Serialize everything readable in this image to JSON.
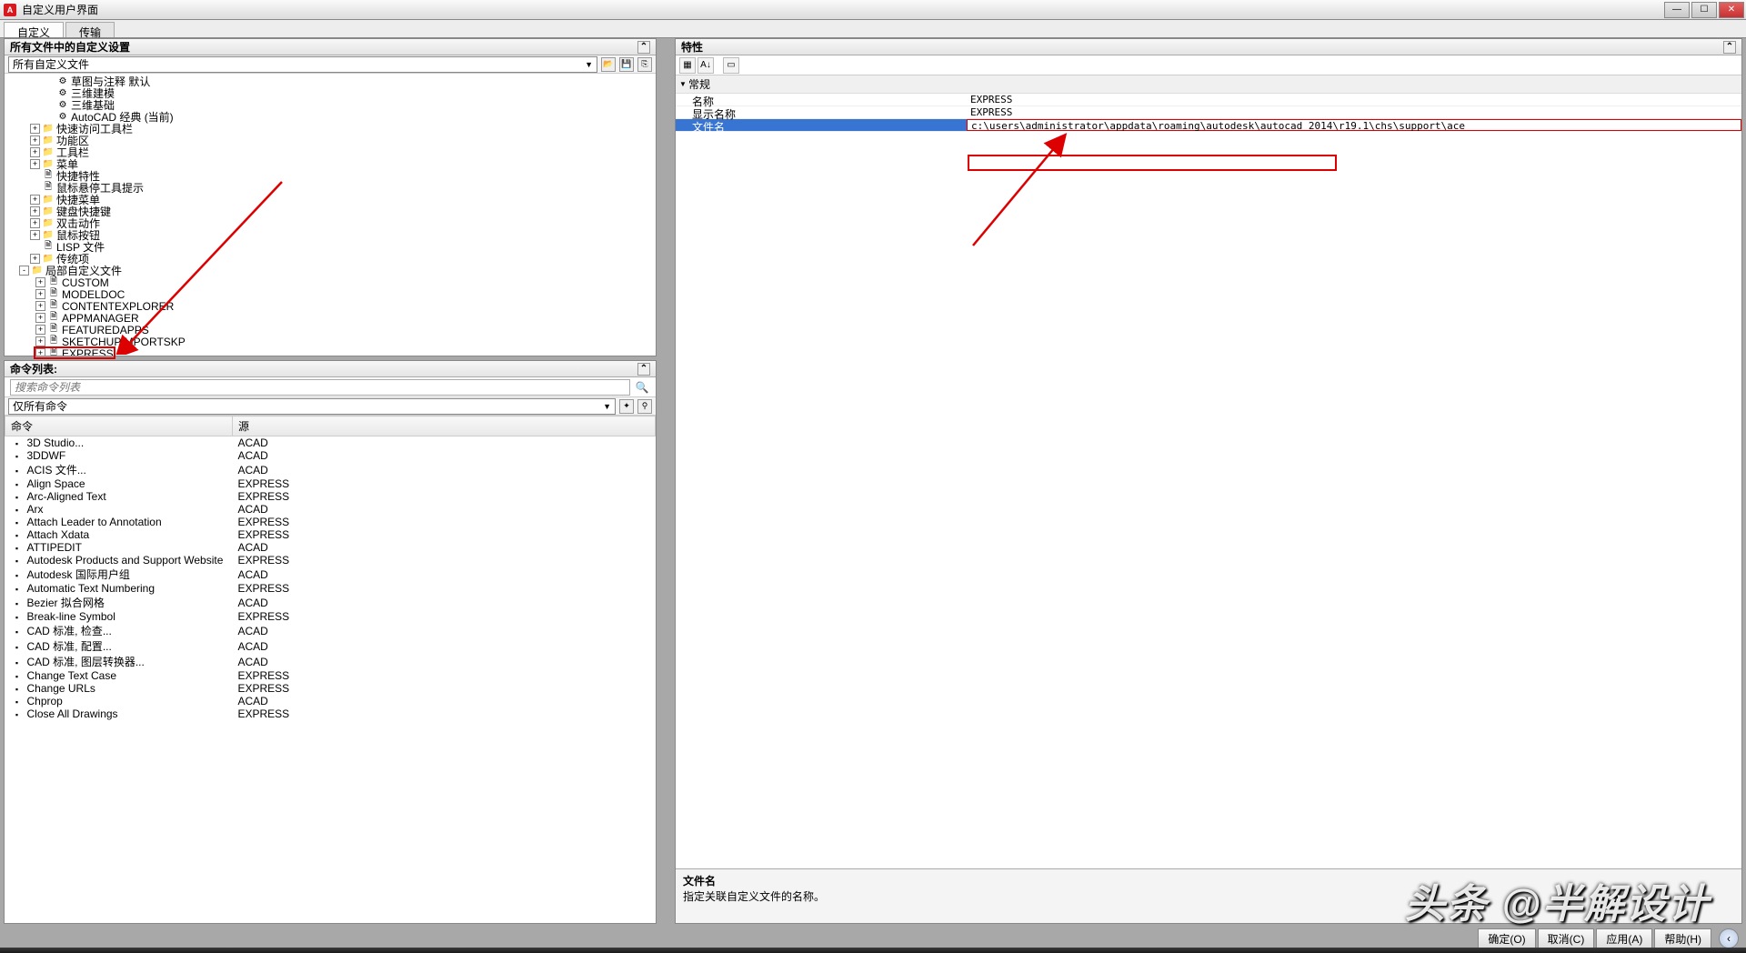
{
  "window": {
    "title": "自定义用户界面"
  },
  "tabs": [
    "自定义",
    "传输"
  ],
  "left": {
    "panel1_title": "所有文件中的自定义设置",
    "filter_label": "所有自定义文件",
    "tree": [
      {
        "ind": 40,
        "exp": "",
        "ico": "⚙",
        "txt": "草图与注释 默认"
      },
      {
        "ind": 40,
        "exp": "",
        "ico": "⚙",
        "txt": "三维建模"
      },
      {
        "ind": 40,
        "exp": "",
        "ico": "⚙",
        "txt": "三维基础"
      },
      {
        "ind": 40,
        "exp": "",
        "ico": "⚙",
        "txt": "AutoCAD 经典 (当前)"
      },
      {
        "ind": 24,
        "exp": "+",
        "ico": "📁",
        "txt": "快速访问工具栏"
      },
      {
        "ind": 24,
        "exp": "+",
        "ico": "📁",
        "txt": "功能区"
      },
      {
        "ind": 24,
        "exp": "+",
        "ico": "📁",
        "txt": "工具栏"
      },
      {
        "ind": 24,
        "exp": "+",
        "ico": "📁",
        "txt": "菜单"
      },
      {
        "ind": 24,
        "exp": "",
        "ico": "🗎",
        "txt": "快捷特性"
      },
      {
        "ind": 24,
        "exp": "",
        "ico": "🗎",
        "txt": "鼠标悬停工具提示"
      },
      {
        "ind": 24,
        "exp": "+",
        "ico": "📁",
        "txt": "快捷菜单"
      },
      {
        "ind": 24,
        "exp": "+",
        "ico": "📁",
        "txt": "键盘快捷键"
      },
      {
        "ind": 24,
        "exp": "+",
        "ico": "📁",
        "txt": "双击动作"
      },
      {
        "ind": 24,
        "exp": "+",
        "ico": "📁",
        "txt": "鼠标按钮"
      },
      {
        "ind": 24,
        "exp": "",
        "ico": "🗎",
        "txt": "LISP 文件"
      },
      {
        "ind": 24,
        "exp": "+",
        "ico": "📁",
        "txt": "传统项"
      },
      {
        "ind": 12,
        "exp": "-",
        "ico": "📁",
        "txt": "局部自定义文件"
      },
      {
        "ind": 30,
        "exp": "+",
        "ico": "🗎",
        "txt": "CUSTOM"
      },
      {
        "ind": 30,
        "exp": "+",
        "ico": "🗎",
        "txt": "MODELDOC"
      },
      {
        "ind": 30,
        "exp": "+",
        "ico": "🗎",
        "txt": "CONTENTEXPLORER"
      },
      {
        "ind": 30,
        "exp": "+",
        "ico": "🗎",
        "txt": "APPMANAGER"
      },
      {
        "ind": 30,
        "exp": "+",
        "ico": "🗎",
        "txt": "FEATUREDAPPS"
      },
      {
        "ind": 30,
        "exp": "+",
        "ico": "🗎",
        "txt": "SKETCHUPIMPORTSKP"
      },
      {
        "ind": 30,
        "exp": "+",
        "ico": "🗎",
        "txt": "EXPRESS"
      }
    ],
    "panel2_title": "命令列表:",
    "search_placeholder": "搜索命令列表",
    "filter2_label": "仅所有命令",
    "cmd_headers": {
      "c1": "命令",
      "c2": "源"
    },
    "commands": [
      {
        "n": "3D Studio...",
        "s": "ACAD"
      },
      {
        "n": "3DDWF",
        "s": "ACAD"
      },
      {
        "n": "ACIS 文件...",
        "s": "ACAD"
      },
      {
        "n": "Align Space",
        "s": "EXPRESS"
      },
      {
        "n": "Arc-Aligned Text",
        "s": "EXPRESS"
      },
      {
        "n": "Arx",
        "s": "ACAD"
      },
      {
        "n": "Attach Leader to Annotation",
        "s": "EXPRESS"
      },
      {
        "n": "Attach Xdata",
        "s": "EXPRESS"
      },
      {
        "n": "ATTIPEDIT",
        "s": "ACAD"
      },
      {
        "n": "Autodesk Products and Support Website",
        "s": "EXPRESS"
      },
      {
        "n": "Autodesk 国际用户组",
        "s": "ACAD"
      },
      {
        "n": "Automatic Text Numbering",
        "s": "EXPRESS"
      },
      {
        "n": "Bezier 拟合网格",
        "s": "ACAD"
      },
      {
        "n": "Break-line Symbol",
        "s": "EXPRESS"
      },
      {
        "n": "CAD 标准, 检查...",
        "s": "ACAD"
      },
      {
        "n": "CAD 标准, 配置...",
        "s": "ACAD"
      },
      {
        "n": "CAD 标准, 图层转换器...",
        "s": "ACAD"
      },
      {
        "n": "Change Text Case",
        "s": "EXPRESS"
      },
      {
        "n": "Change URLs",
        "s": "EXPRESS"
      },
      {
        "n": "Chprop",
        "s": "ACAD"
      },
      {
        "n": "Close All Drawings",
        "s": "EXPRESS"
      }
    ]
  },
  "right": {
    "panel_title": "特性",
    "category": "常规",
    "rows": [
      {
        "k": "名称",
        "v": "EXPRESS"
      },
      {
        "k": "显示名称",
        "v": "EXPRESS"
      },
      {
        "k": "文件名",
        "v": "c:\\users\\administrator\\appdata\\roaming\\autodesk\\autocad 2014\\r19.1\\chs\\support\\ace"
      }
    ],
    "desc_title": "文件名",
    "desc_body": "指定关联自定义文件的名称。"
  },
  "buttons": {
    "ok": "确定(O)",
    "cancel": "取消(C)",
    "apply": "应用(A)",
    "help": "帮助(H)"
  },
  "watermark": "头条 @半解设计"
}
